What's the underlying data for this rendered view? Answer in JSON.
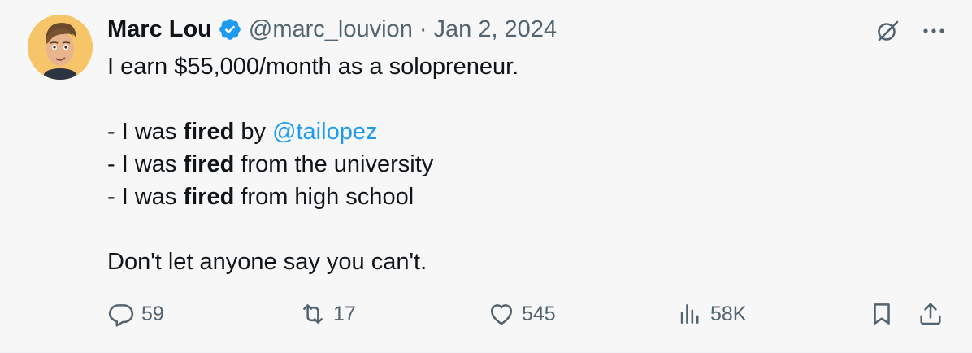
{
  "author": {
    "name": "Marc Lou",
    "handle": "@marc_louvion",
    "separator": "·",
    "date": "Jan 2, 2024",
    "verified": true
  },
  "tweet": {
    "line1": "I earn $55,000/month as a solopreneur.",
    "item1_prefix": "- I was ",
    "item1_bold": "fired",
    "item1_mid": " by ",
    "item1_mention": "@tailopez",
    "item2_prefix": "- I was ",
    "item2_bold": "fired",
    "item2_suffix": " from the university",
    "item3_prefix": "- I was ",
    "item3_bold": "fired",
    "item3_suffix": " from high school",
    "closing": "Don't let anyone say you can't."
  },
  "actions": {
    "replies": "59",
    "reposts": "17",
    "likes": "545",
    "views": "58K"
  },
  "icons": {
    "verified": "verified-badge-icon",
    "grok": "grok-icon",
    "more": "more-icon",
    "reply": "reply-icon",
    "repost": "repost-icon",
    "like": "heart-icon",
    "views": "views-icon",
    "bookmark": "bookmark-icon",
    "share": "share-icon"
  },
  "colors": {
    "accent": "#1d9bf0",
    "muted": "#536471",
    "text": "#0f1419",
    "background": "#f7f7f7"
  }
}
